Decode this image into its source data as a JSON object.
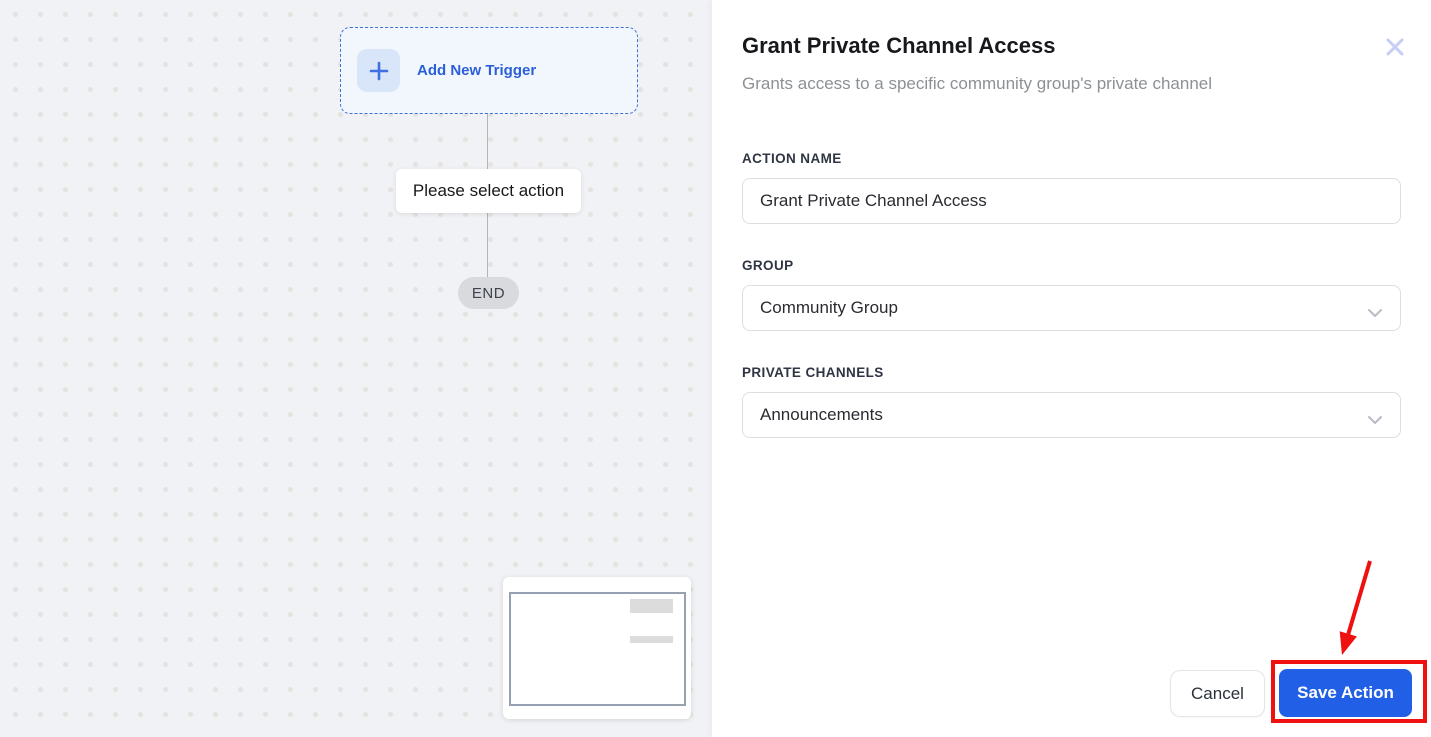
{
  "canvas": {
    "trigger_label": "Add New Trigger",
    "action_placeholder_label": "Please select action",
    "end_label": "END"
  },
  "panel": {
    "title": "Grant Private Channel Access",
    "subtitle": "Grants access to a specific community group's private channel",
    "fields": [
      {
        "label": "ACTION NAME",
        "type": "text",
        "value": "Grant Private Channel Access"
      },
      {
        "label": "GROUP",
        "type": "select",
        "value": "Community Group"
      },
      {
        "label": "PRIVATE CHANNELS",
        "type": "select",
        "value": "Announcements"
      }
    ],
    "footer": {
      "cancel_label": "Cancel",
      "save_label": "Save Action"
    }
  },
  "icons": {
    "plus": "plus-icon",
    "close": "close-icon",
    "chevron": "chevron-down-icon"
  },
  "colors": {
    "accent_blue": "#2b5fd9",
    "save_blue": "#2160e6",
    "annotation_red": "#ef1010",
    "canvas_bg": "#f1f2f5",
    "end_pill_bg": "#d8dade"
  }
}
